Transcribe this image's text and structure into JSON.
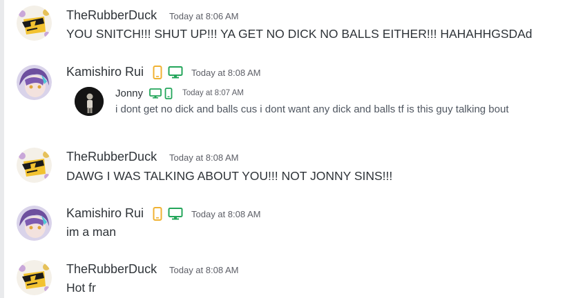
{
  "colors": {
    "mobile_icon": "#f0b232",
    "desktop_icon": "#23a55a",
    "text_primary": "#2e3338",
    "text_muted": "#5c5e66"
  },
  "messages": [
    {
      "author": "TheRubberDuck",
      "timestamp": "Today at 8:06 AM",
      "text": "YOU SNITCH!!! SHUT UP!!! YA GET NO DICK NO BALLS EITHER!!! HAHAHHGSDAd"
    },
    {
      "author": "Kamishiro Rui",
      "timestamp": "Today at 8:08 AM",
      "status_icons": [
        "mobile-icon",
        "desktop-icon"
      ],
      "reply": {
        "author": "Jonny",
        "status_icons": [
          "desktop-icon",
          "mobile-icon"
        ],
        "timestamp": "Today at 8:07 AM",
        "text": "i dont get no dick and balls cus i dont want any dick and balls tf is this guy talking bout"
      }
    },
    {
      "author": "TheRubberDuck",
      "timestamp": "Today at 8:08 AM",
      "text": "DAWG I WAS TALKING ABOUT YOU!!! NOT JONNY SINS!!!"
    },
    {
      "author": "Kamishiro Rui",
      "timestamp": "Today at 8:08 AM",
      "status_icons": [
        "mobile-icon",
        "desktop-icon"
      ],
      "text": "im a man"
    },
    {
      "author": "TheRubberDuck",
      "timestamp": "Today at 8:08 AM",
      "text": "Hot fr"
    }
  ]
}
